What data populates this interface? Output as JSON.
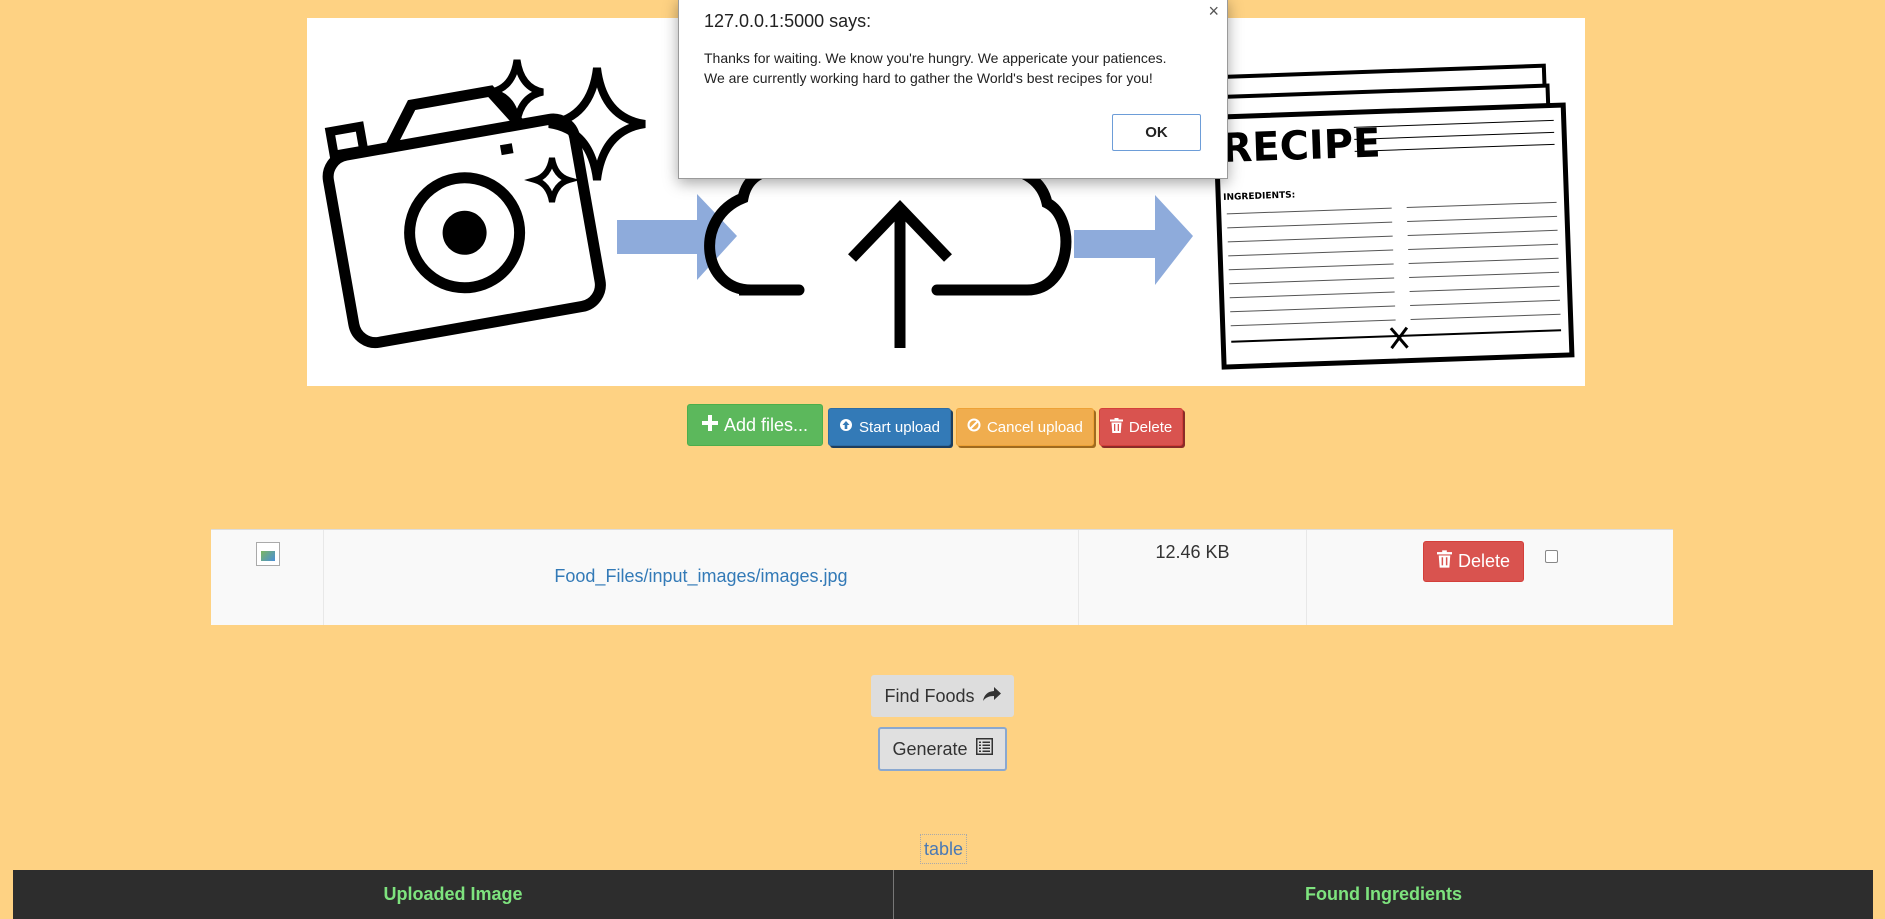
{
  "dialog": {
    "title": "127.0.0.1:5000 says:",
    "message_line1": "Thanks for waiting. We know you're hungry. We appericate your patiences.",
    "message_line2": "We are currently working hard to gather the World's best recipes for you!",
    "ok_label": "OK",
    "close_glyph": "×"
  },
  "hero": {
    "recipe_word": "RECIPE",
    "ingredients_label": "INGREDIENTS:"
  },
  "toolbar": {
    "add_label": "Add files...",
    "start_label": "Start upload",
    "cancel_label": "Cancel upload",
    "delete_label": "Delete"
  },
  "files": [
    {
      "name": "Food_Files/input_images/images.jpg",
      "size": "12.46 KB",
      "delete_label": "Delete"
    }
  ],
  "actions": {
    "find_label": "Find Foods",
    "generate_label": "Generate"
  },
  "results": {
    "table_link": "table",
    "col1": "Uploaded Image",
    "col2": "Found Ingredients"
  },
  "colors": {
    "background": "#fed283",
    "success": "#5cb85c",
    "primary": "#337ab7",
    "warning": "#f0ad4e",
    "danger": "#d9534f",
    "header_text": "#7ee37e"
  }
}
